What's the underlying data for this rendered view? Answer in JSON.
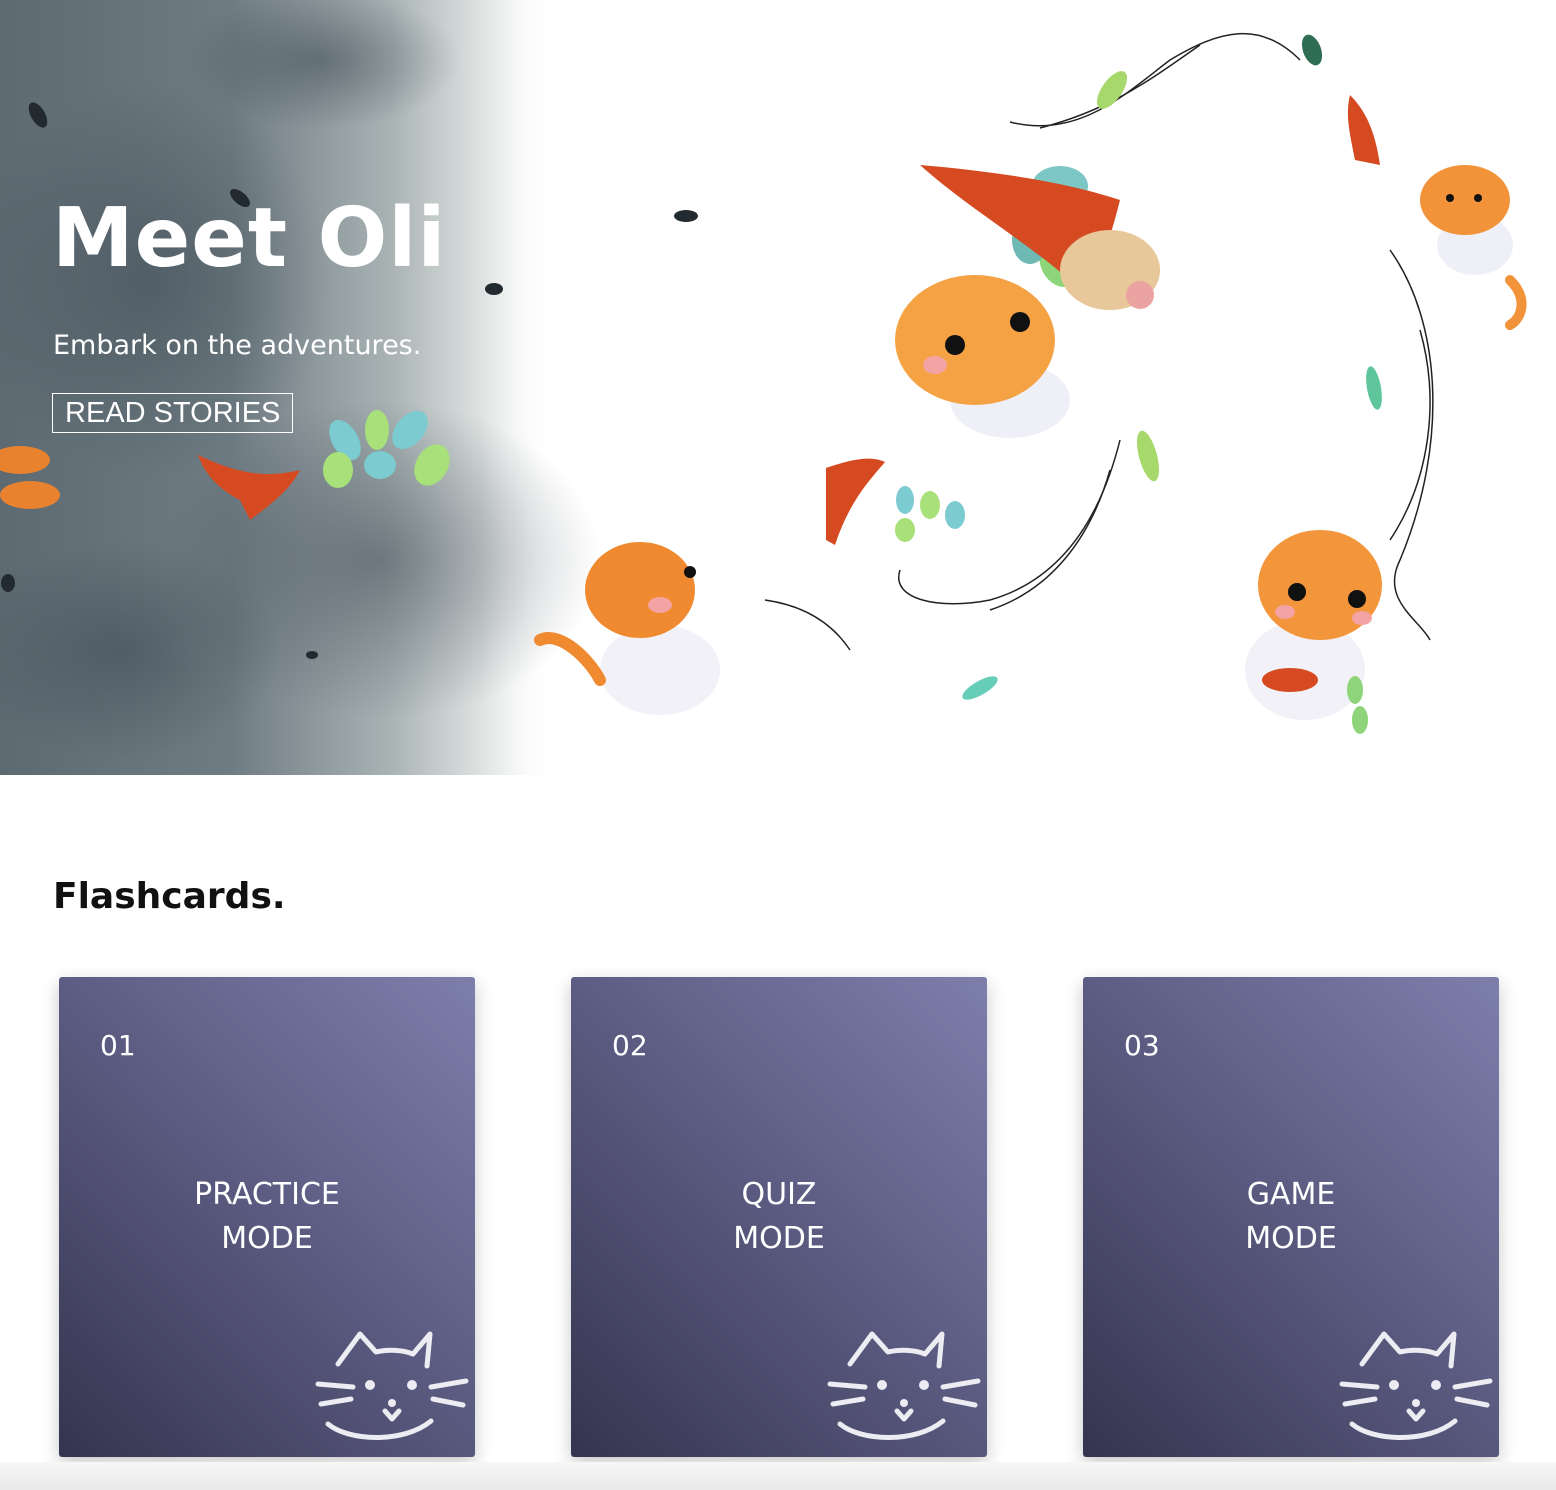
{
  "hero": {
    "title": "Meet Oli",
    "subtitle": "Embark on the adventures.",
    "cta_label": "READ STORIES"
  },
  "flashcards": {
    "heading": "Flashcards.",
    "cards": [
      {
        "number": "01",
        "line1": "PRACTICE",
        "line2": "MODE",
        "icon": "cat-icon"
      },
      {
        "number": "02",
        "line1": "QUIZ",
        "line2": "MODE",
        "icon": "cat-icon"
      },
      {
        "number": "03",
        "line1": "GAME",
        "line2": "MODE",
        "icon": "cat-icon"
      }
    ]
  },
  "colors": {
    "card_gradient_light": "#7d7fab",
    "card_gradient_dark": "#35344f",
    "hero_wash": "#6e7a80"
  }
}
